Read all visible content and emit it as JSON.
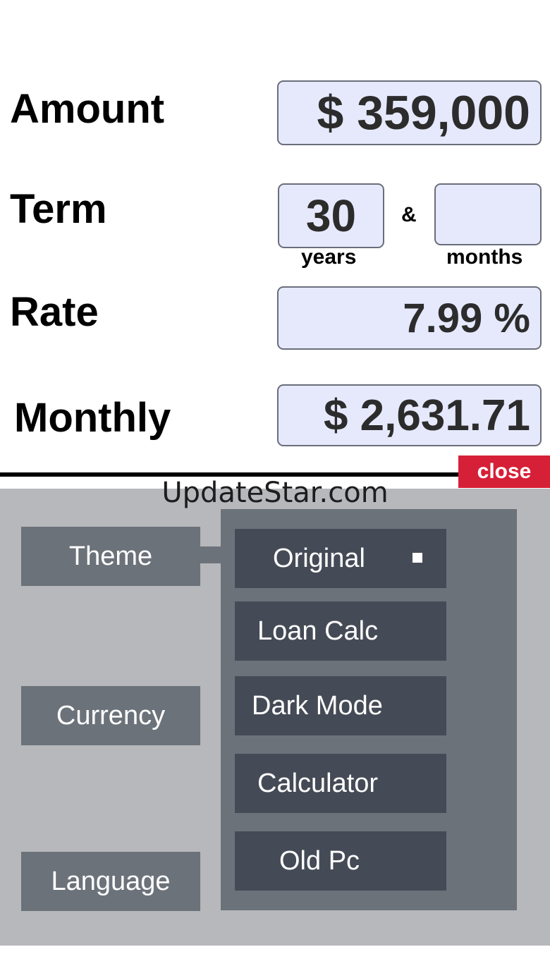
{
  "form": {
    "amount_label": "Amount",
    "amount_value": "$ 359,000",
    "term_label": "Term",
    "term_years_value": "30",
    "term_ampersand": "&",
    "term_months_value": "",
    "years_label": "years",
    "months_label": "months",
    "rate_label": "Rate",
    "rate_value": "7.99 %",
    "monthly_label": "Monthly",
    "monthly_value": "$ 2,631.71"
  },
  "close_label": "close",
  "watermark": "UpdateStar.com",
  "settings": {
    "menu": [
      "Theme",
      "Currency",
      "Language"
    ],
    "themes": [
      "Original",
      "Loan Calc",
      "Dark Mode",
      "Calculator",
      "Old Pc"
    ],
    "selected_theme": "Original"
  },
  "colors": {
    "field_bg": "#e6e9fc",
    "close_red": "#d62037",
    "panel_bg": "#b7b8bb",
    "menu_btn": "#6c727a",
    "sub_btn": "#454b56"
  }
}
